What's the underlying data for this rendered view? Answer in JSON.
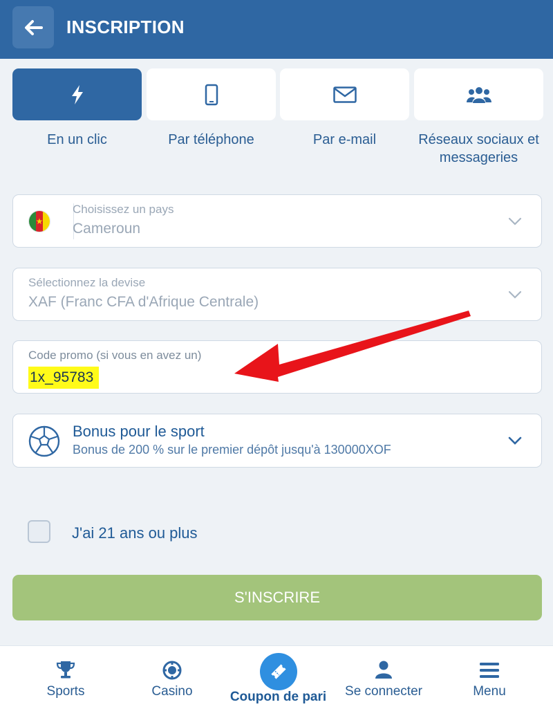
{
  "header": {
    "title": "INSCRIPTION"
  },
  "tabs": [
    {
      "label": "En un clic",
      "icon": "lightning-icon",
      "active": true
    },
    {
      "label": "Par téléphone",
      "icon": "phone-icon",
      "active": false
    },
    {
      "label": "Par e-mail",
      "icon": "envelope-icon",
      "active": false
    },
    {
      "label": "Réseaux sociaux et messageries",
      "icon": "users-icon",
      "active": false
    }
  ],
  "form": {
    "country": {
      "label": "Choisissez un pays",
      "value": "Cameroun"
    },
    "currency": {
      "label": "Sélectionnez la devise",
      "value": "XAF (Franc CFA d'Afrique Centrale)"
    },
    "promo": {
      "label": "Code promo (si vous en avez un)",
      "value": "1x_95783"
    },
    "bonus": {
      "title": "Bonus pour le sport",
      "subtitle": "Bonus de 200 % sur le premier dépôt jusqu'à 130000XOF"
    },
    "age_checkbox": {
      "label": "J'ai 21 ans ou plus",
      "checked": false
    },
    "submit_label": "S'INSCRIRE"
  },
  "bottom_nav": [
    {
      "label": "Sports",
      "icon": "trophy-icon"
    },
    {
      "label": "Casino",
      "icon": "casino-chip-icon"
    },
    {
      "label": "Coupon de pari",
      "icon": "ticket-icon",
      "active": true
    },
    {
      "label": "Se connecter",
      "icon": "user-icon"
    },
    {
      "label": "Menu",
      "icon": "hamburger-icon"
    }
  ],
  "colors": {
    "primary": "#2f67a3",
    "background": "#eef2f6",
    "submit": "#a3c47b",
    "highlight": "#fffb19",
    "annotation_arrow": "#e8141a",
    "coupon_circle": "#2f8fe0"
  }
}
